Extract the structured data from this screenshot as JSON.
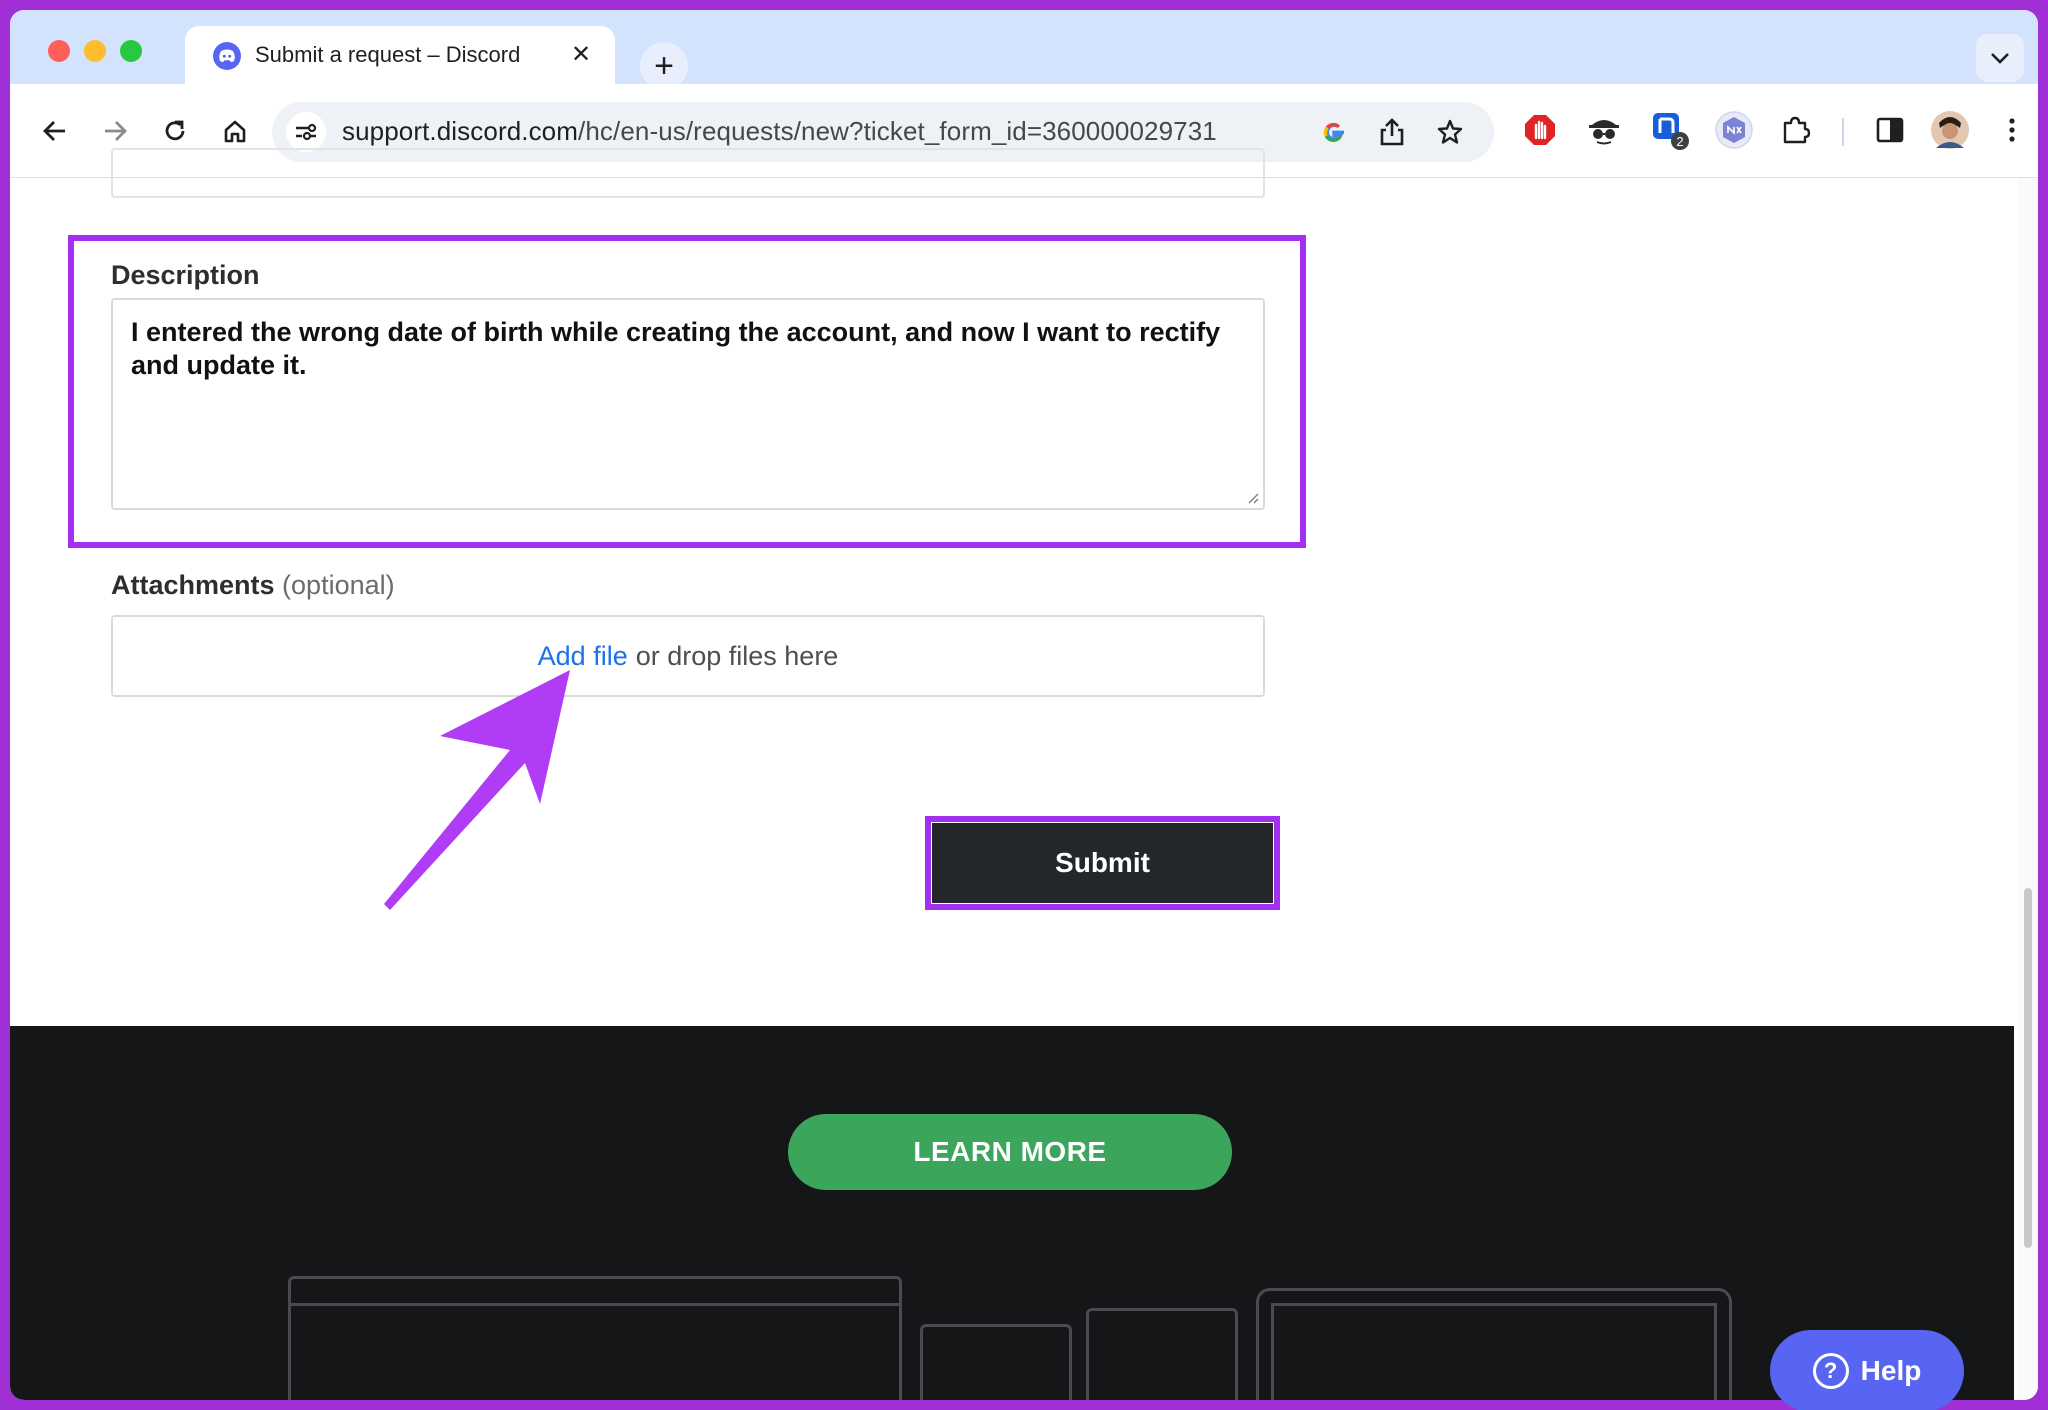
{
  "browser": {
    "tab_title": "Submit a request – Discord",
    "tab_close": "✕",
    "new_tab": "+",
    "url_host": "support.discord.com",
    "url_path": "/hc/en-us/requests/new?ticket_form_id=360000029731",
    "extension_badge": "2"
  },
  "form": {
    "description_label": "Description",
    "description_value": "I entered the wrong date of birth while creating the account, and now I want to rectify and update it.",
    "attachments_label": "Attachments",
    "attachments_optional": "(optional)",
    "add_file": "Add file",
    "drop_text": "or drop files here",
    "submit_label": "Submit"
  },
  "footer": {
    "learn_more": "LEARN MORE"
  },
  "help_widget": {
    "label": "Help",
    "icon_glyph": "?"
  },
  "colors": {
    "highlight": "#a42ff1",
    "discord_blurple": "#5865f2",
    "learn_more_green": "#3ba55c",
    "submit_dark": "#23272a"
  }
}
